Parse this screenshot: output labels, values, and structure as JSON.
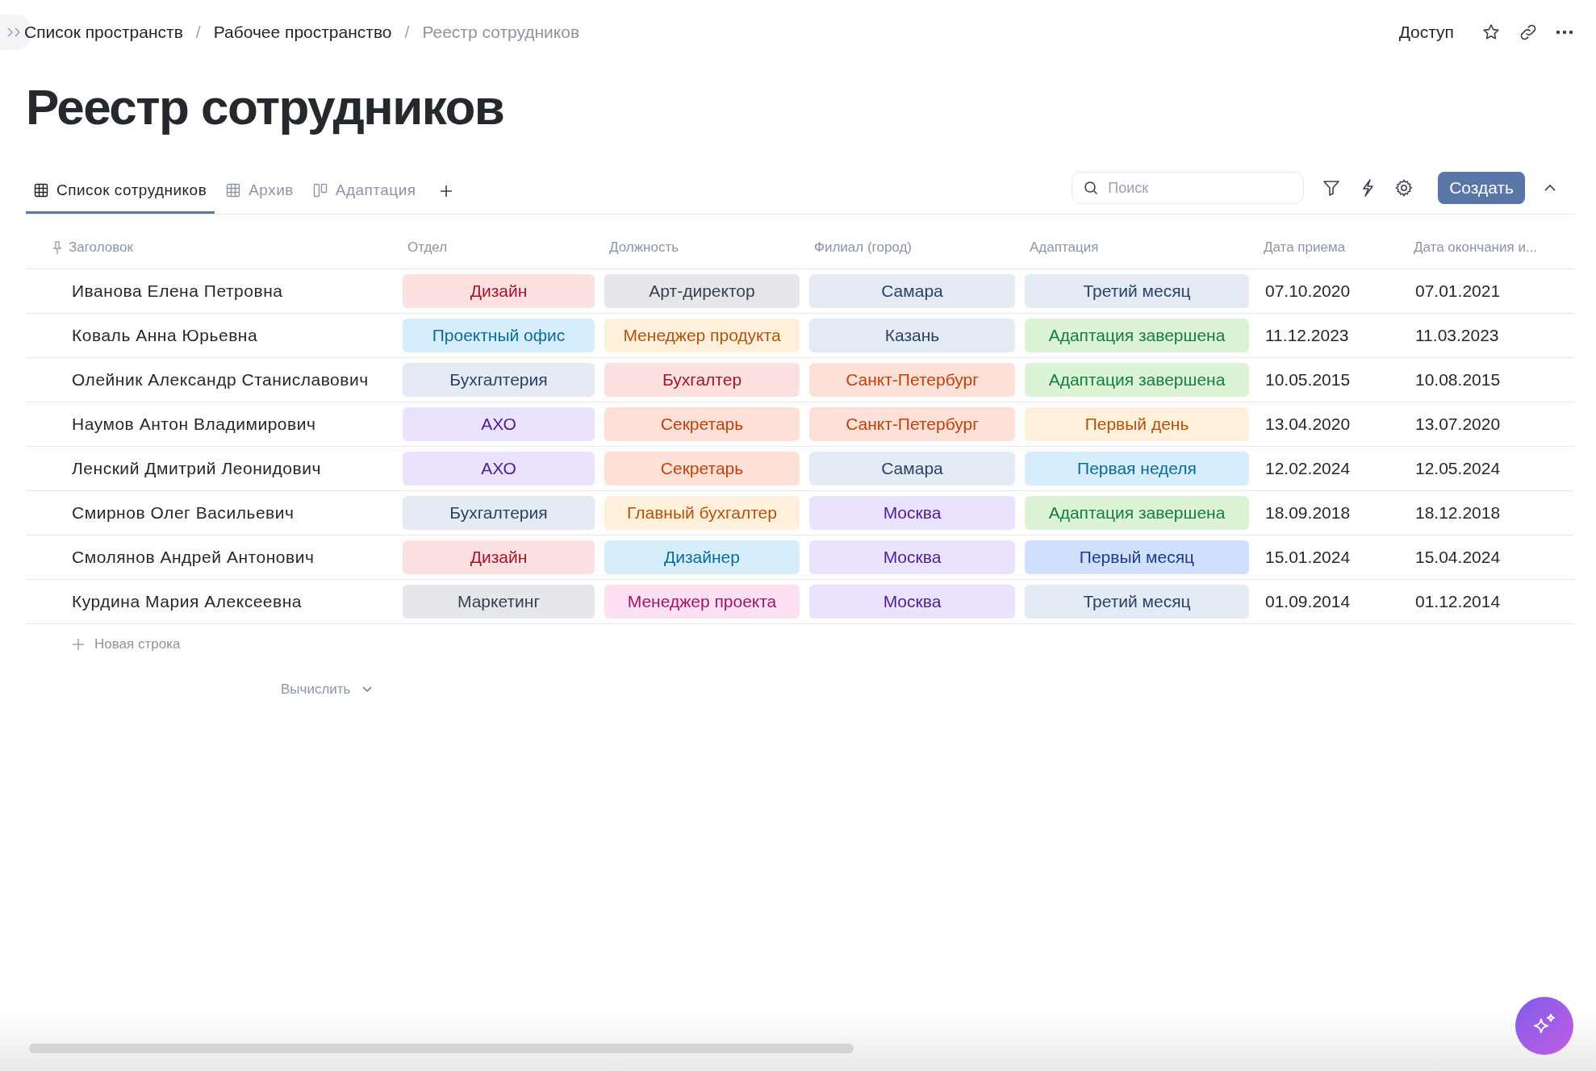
{
  "breadcrumbs": [
    {
      "label": "Список пространств",
      "current": false
    },
    {
      "separator": "/",
      "label": "Рабочее пространство",
      "current": false
    },
    {
      "separator": "/",
      "label": "Реестр сотрудников",
      "current": true
    }
  ],
  "header_actions": {
    "access": "Доступ"
  },
  "title": "Реестр сотрудников",
  "tabs": [
    {
      "label": "Список сотрудников",
      "kind": "table",
      "selected": true
    },
    {
      "label": "Архив",
      "kind": "table",
      "selected": false
    },
    {
      "label": "Адаптация",
      "kind": "board",
      "selected": false
    }
  ],
  "toolbar": {
    "search_placeholder": "Поиск",
    "create_button": "Создать"
  },
  "table": {
    "columns": [
      "Заголовок",
      "Отдел",
      "Должность",
      "Филиал (город)",
      "Адаптация",
      "Дата приема",
      "Дата окончания и..."
    ],
    "rows": [
      {
        "name": "Иванова Елена Петровна",
        "department": {
          "label": "Дизайн",
          "color": "#fde0e0"
        },
        "position": {
          "label": "Арт-директор",
          "color": "#e5e7eb"
        },
        "branch": {
          "label": "Самара",
          "color": "#e4ebf5"
        },
        "adaptation": {
          "label": "Третий месяц",
          "color": "#e4ebf5"
        },
        "hire_date": "07.10.2020",
        "end_date": "07.01.2021"
      },
      {
        "name": "Коваль Анна Юрьевна",
        "department": {
          "label": "Проектный офис",
          "color": "#d6eefb"
        },
        "position": {
          "label": "Менеджер продукта",
          "color": "#fff0dc"
        },
        "branch": {
          "label": "Казань",
          "color": "#e4ebf5"
        },
        "adaptation": {
          "label": "Адаптация завершена",
          "color": "#dcf3d6"
        },
        "hire_date": "11.12.2023",
        "end_date": "11.03.2023"
      },
      {
        "name": "Олейник Александр Станиславович",
        "department": {
          "label": "Бухгалтерия",
          "color": "#e4ebf5"
        },
        "position": {
          "label": "Бухгалтер",
          "color": "#fde0e0"
        },
        "branch": {
          "label": "Санкт-Петербург",
          "color": "#fde0d8"
        },
        "adaptation": {
          "label": "Адаптация завершена",
          "color": "#dcf3d6"
        },
        "hire_date": "10.05.2015",
        "end_date": "10.08.2015"
      },
      {
        "name": "Наумов Антон Владимирович",
        "department": {
          "label": "АХО",
          "color": "#ebe3fd"
        },
        "position": {
          "label": "Секретарь",
          "color": "#fde0d8"
        },
        "branch": {
          "label": "Санкт-Петербург",
          "color": "#fde0d8"
        },
        "adaptation": {
          "label": "Первый день",
          "color": "#fff0dc"
        },
        "hire_date": "13.04.2020",
        "end_date": "13.07.2020"
      },
      {
        "name": "Ленский Дмитрий Леонидович",
        "department": {
          "label": "АХО",
          "color": "#ebe3fd"
        },
        "position": {
          "label": "Секретарь",
          "color": "#fde0d8"
        },
        "branch": {
          "label": "Самара",
          "color": "#e4ebf5"
        },
        "adaptation": {
          "label": "Первая неделя",
          "color": "#d6eefb"
        },
        "hire_date": "12.02.2024",
        "end_date": "12.05.2024"
      },
      {
        "name": "Смирнов Олег Васильевич",
        "department": {
          "label": "Бухгалтерия",
          "color": "#e4ebf5"
        },
        "position": {
          "label": "Главный бухгалтер",
          "color": "#fff0dc"
        },
        "branch": {
          "label": "Москва",
          "color": "#ebe3fd"
        },
        "adaptation": {
          "label": "Адаптация завершена",
          "color": "#dcf3d6"
        },
        "hire_date": "18.09.2018",
        "end_date": "18.12.2018"
      },
      {
        "name": "Смолянов Андрей Антонович",
        "department": {
          "label": "Дизайн",
          "color": "#fde0e0"
        },
        "position": {
          "label": "Дизайнер",
          "color": "#d6eefb"
        },
        "branch": {
          "label": "Москва",
          "color": "#ebe3fd"
        },
        "adaptation": {
          "label": "Первый месяц",
          "color": "#cfe0fd"
        },
        "hire_date": "15.01.2024",
        "end_date": "15.04.2024"
      },
      {
        "name": "Курдина Мария Алексеевна",
        "department": {
          "label": "Маркетинг",
          "color": "#e5e7eb"
        },
        "position": {
          "label": "Менеджер проекта",
          "color": "#fde0f2"
        },
        "branch": {
          "label": "Москва",
          "color": "#ebe3fd"
        },
        "adaptation": {
          "label": "Третий месяц",
          "color": "#e4ebf5"
        },
        "hire_date": "01.09.2014",
        "end_date": "01.12.2014"
      }
    ],
    "new_row": "Новая строка",
    "calculate": "Вычислить"
  }
}
